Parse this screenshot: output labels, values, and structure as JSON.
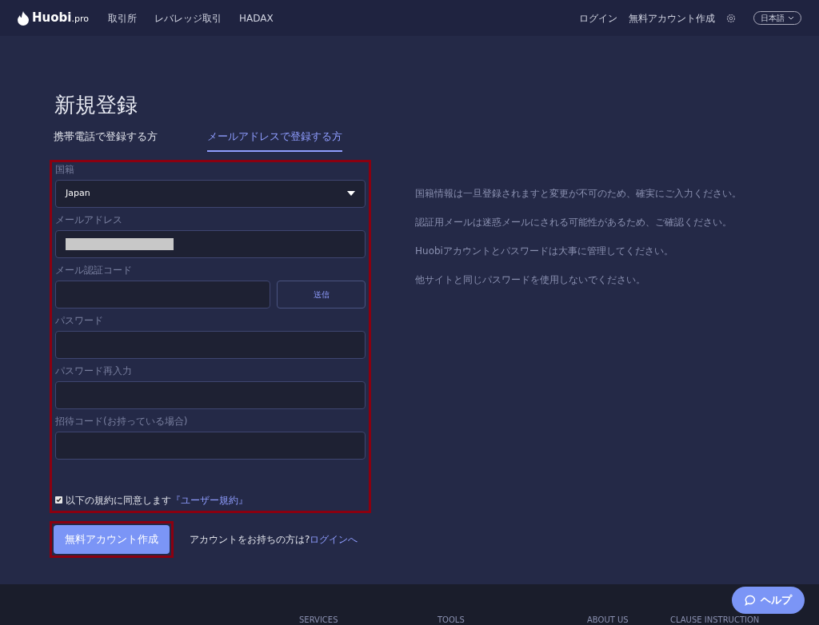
{
  "header": {
    "logo": "Huobi",
    "logo_suffix": ".pro",
    "nav": [
      "取引所",
      "レバレッジ取引",
      "HADAX"
    ],
    "right_links": [
      "ログイン",
      "無料アカウント作成"
    ],
    "language": "日本語"
  },
  "title": "新規登録",
  "tabs": [
    {
      "label": "携帯電話で登録する方",
      "selected": false
    },
    {
      "label": "メールアドレスで登録する方",
      "selected": true
    }
  ],
  "form": {
    "highlighted": true,
    "fields": [
      {
        "kind": "select",
        "label": "国籍",
        "value": "Japan"
      },
      {
        "kind": "redacted",
        "label": "メールアドレス"
      },
      {
        "kind": "code",
        "label": "メール認証コード",
        "button": "送信"
      },
      {
        "kind": "text",
        "label": "パスワード"
      },
      {
        "kind": "text",
        "label": "パスワード再入力"
      },
      {
        "kind": "text",
        "label": "招待コード(お持っている場合)"
      }
    ],
    "agree": {
      "checked": true,
      "text": "以下の規約に同意します",
      "link": "『ユーザー規約』"
    }
  },
  "submit": {
    "label": "無料アカウント作成",
    "highlighted": true
  },
  "login_prompt": {
    "text": "アカウントをお持ちの方は?",
    "link": "ログインへ"
  },
  "notes": [
    "国籍情報は一旦登録されますと変更が不可のため、確実にご入力ください。",
    "認証用メールは迷惑メールにされる可能性があるため、ご確認ください。",
    "Huobiアカウントとパスワードは大事に管理してください。",
    "他サイトと同じパスワードを使用しないでください。"
  ],
  "footer": {
    "columns": [
      "SERVICES",
      "TOOLS",
      "ABOUT US",
      "CLAUSE INSTRUCTION"
    ]
  },
  "help_button": "ヘルプ"
}
